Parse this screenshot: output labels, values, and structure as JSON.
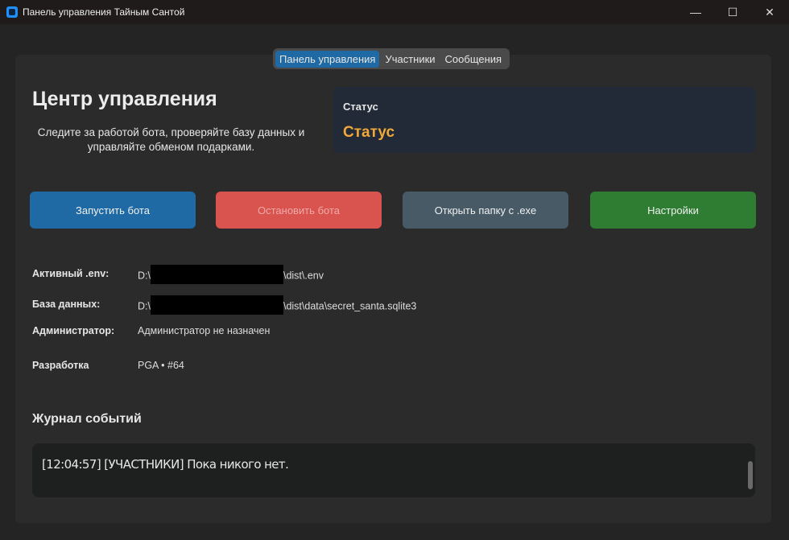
{
  "window": {
    "title": "Панель управления Тайным Сантой",
    "minimize": "—",
    "maximize": "☐",
    "close": "✕"
  },
  "tabs": [
    {
      "label": "Панель управления",
      "active": true
    },
    {
      "label": "Участники"
    },
    {
      "label": "Сообщения"
    }
  ],
  "header": {
    "title": "Центр управления",
    "subtitle": "Следите за работой бота, проверяйте базу данных и управляйте обменом подарками."
  },
  "status": {
    "label": "Статус",
    "value": "Статус",
    "color": "#f0a83a"
  },
  "buttons": {
    "start": "Запустить бота",
    "stop": "Остановить бота",
    "open_folder": "Открыть папку с .exe",
    "settings": "Настройки"
  },
  "info": {
    "env_label": "Активный .env:",
    "env_prefix": "D:\\",
    "env_suffix": "\\dist\\.env",
    "db_label": "База данных:",
    "db_prefix": "D:\\",
    "db_suffix": "\\dist\\data\\secret_santa.sqlite3",
    "admin_label": "Администратор:",
    "admin_value": "Администратор не назначен",
    "dev_label": "Разработка",
    "dev_value": "PGA • #64"
  },
  "log": {
    "title": "Журнал событий",
    "lines": [
      "[12:04:57] [УЧАСТНИКИ] Пока никого нет."
    ]
  }
}
